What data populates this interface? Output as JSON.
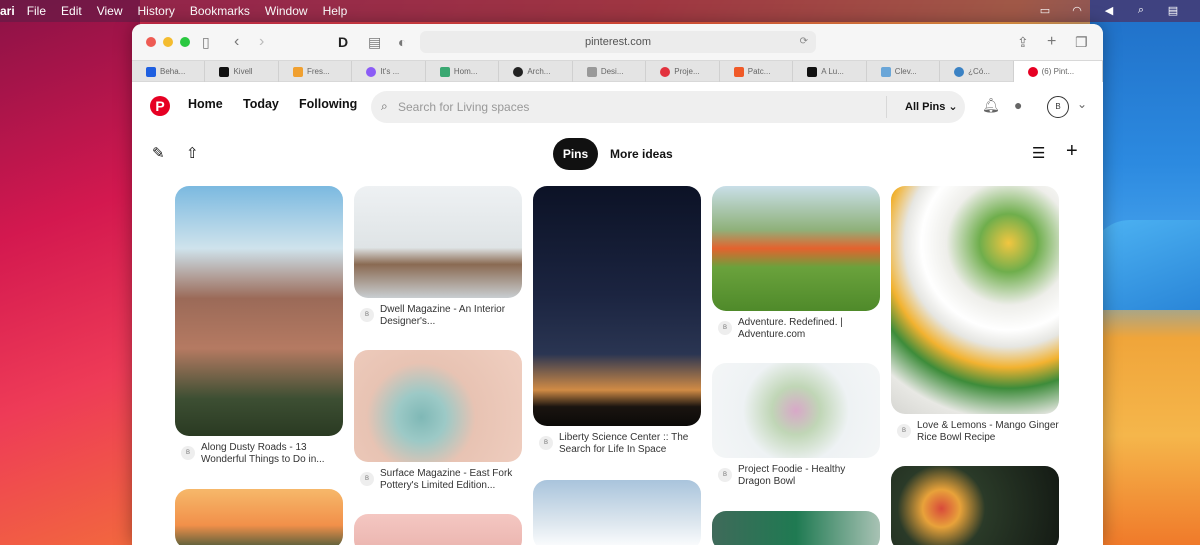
{
  "menubar": {
    "app": "ari",
    "items": [
      "File",
      "Edit",
      "View",
      "History",
      "Bookmarks",
      "Window",
      "Help"
    ]
  },
  "browser": {
    "url": "pinterest.com",
    "tabs": [
      {
        "label": "Beha...",
        "color": "#1f5fe0"
      },
      {
        "label": "Kivell",
        "color": "#111111"
      },
      {
        "label": "Fres...",
        "color": "#f0a030"
      },
      {
        "label": "It's ...",
        "color": "#8b5cf6"
      },
      {
        "label": "Hom...",
        "color": "#3aa872"
      },
      {
        "label": "Arch...",
        "color": "#222222"
      },
      {
        "label": "Desi...",
        "color": "#999999"
      },
      {
        "label": "Proje...",
        "color": "#e2323e"
      },
      {
        "label": "Patc...",
        "color": "#f05a28"
      },
      {
        "label": "A Lu...",
        "color": "#111111"
      },
      {
        "label": "Clev...",
        "color": "#6aa6d8"
      },
      {
        "label": "¿Có...",
        "color": "#3b82c4"
      },
      {
        "label": "(6) Pint...",
        "color": "#e60023"
      }
    ]
  },
  "pinterest": {
    "nav": {
      "home": "Home",
      "today": "Today",
      "following": "Following"
    },
    "search": {
      "placeholder": "Search for Living spaces",
      "scope": "All Pins"
    },
    "avatar": "B",
    "tabs": {
      "pins": "Pins",
      "more": "More ideas"
    },
    "pins": [
      {
        "caption": "Along Dusty Roads - 13 Wonderful Things to Do in...",
        "badge": "B"
      },
      {
        "caption": "Dwell Magazine - An Interior Designer's...",
        "badge": "B"
      },
      {
        "caption": "Surface Magazine - East Fork Pottery's Limited Edition...",
        "badge": "B"
      },
      {
        "caption": "Liberty Science Center :: The Search for Life In Space",
        "badge": "B"
      },
      {
        "caption": "Adventure. Redefined. | Adventure.com",
        "badge": "B"
      },
      {
        "caption": "Project Foodie - Healthy Dragon Bowl",
        "badge": "B"
      },
      {
        "caption": "Love & Lemons - Mango Ginger Rice Bowl Recipe",
        "badge": "B"
      }
    ]
  }
}
